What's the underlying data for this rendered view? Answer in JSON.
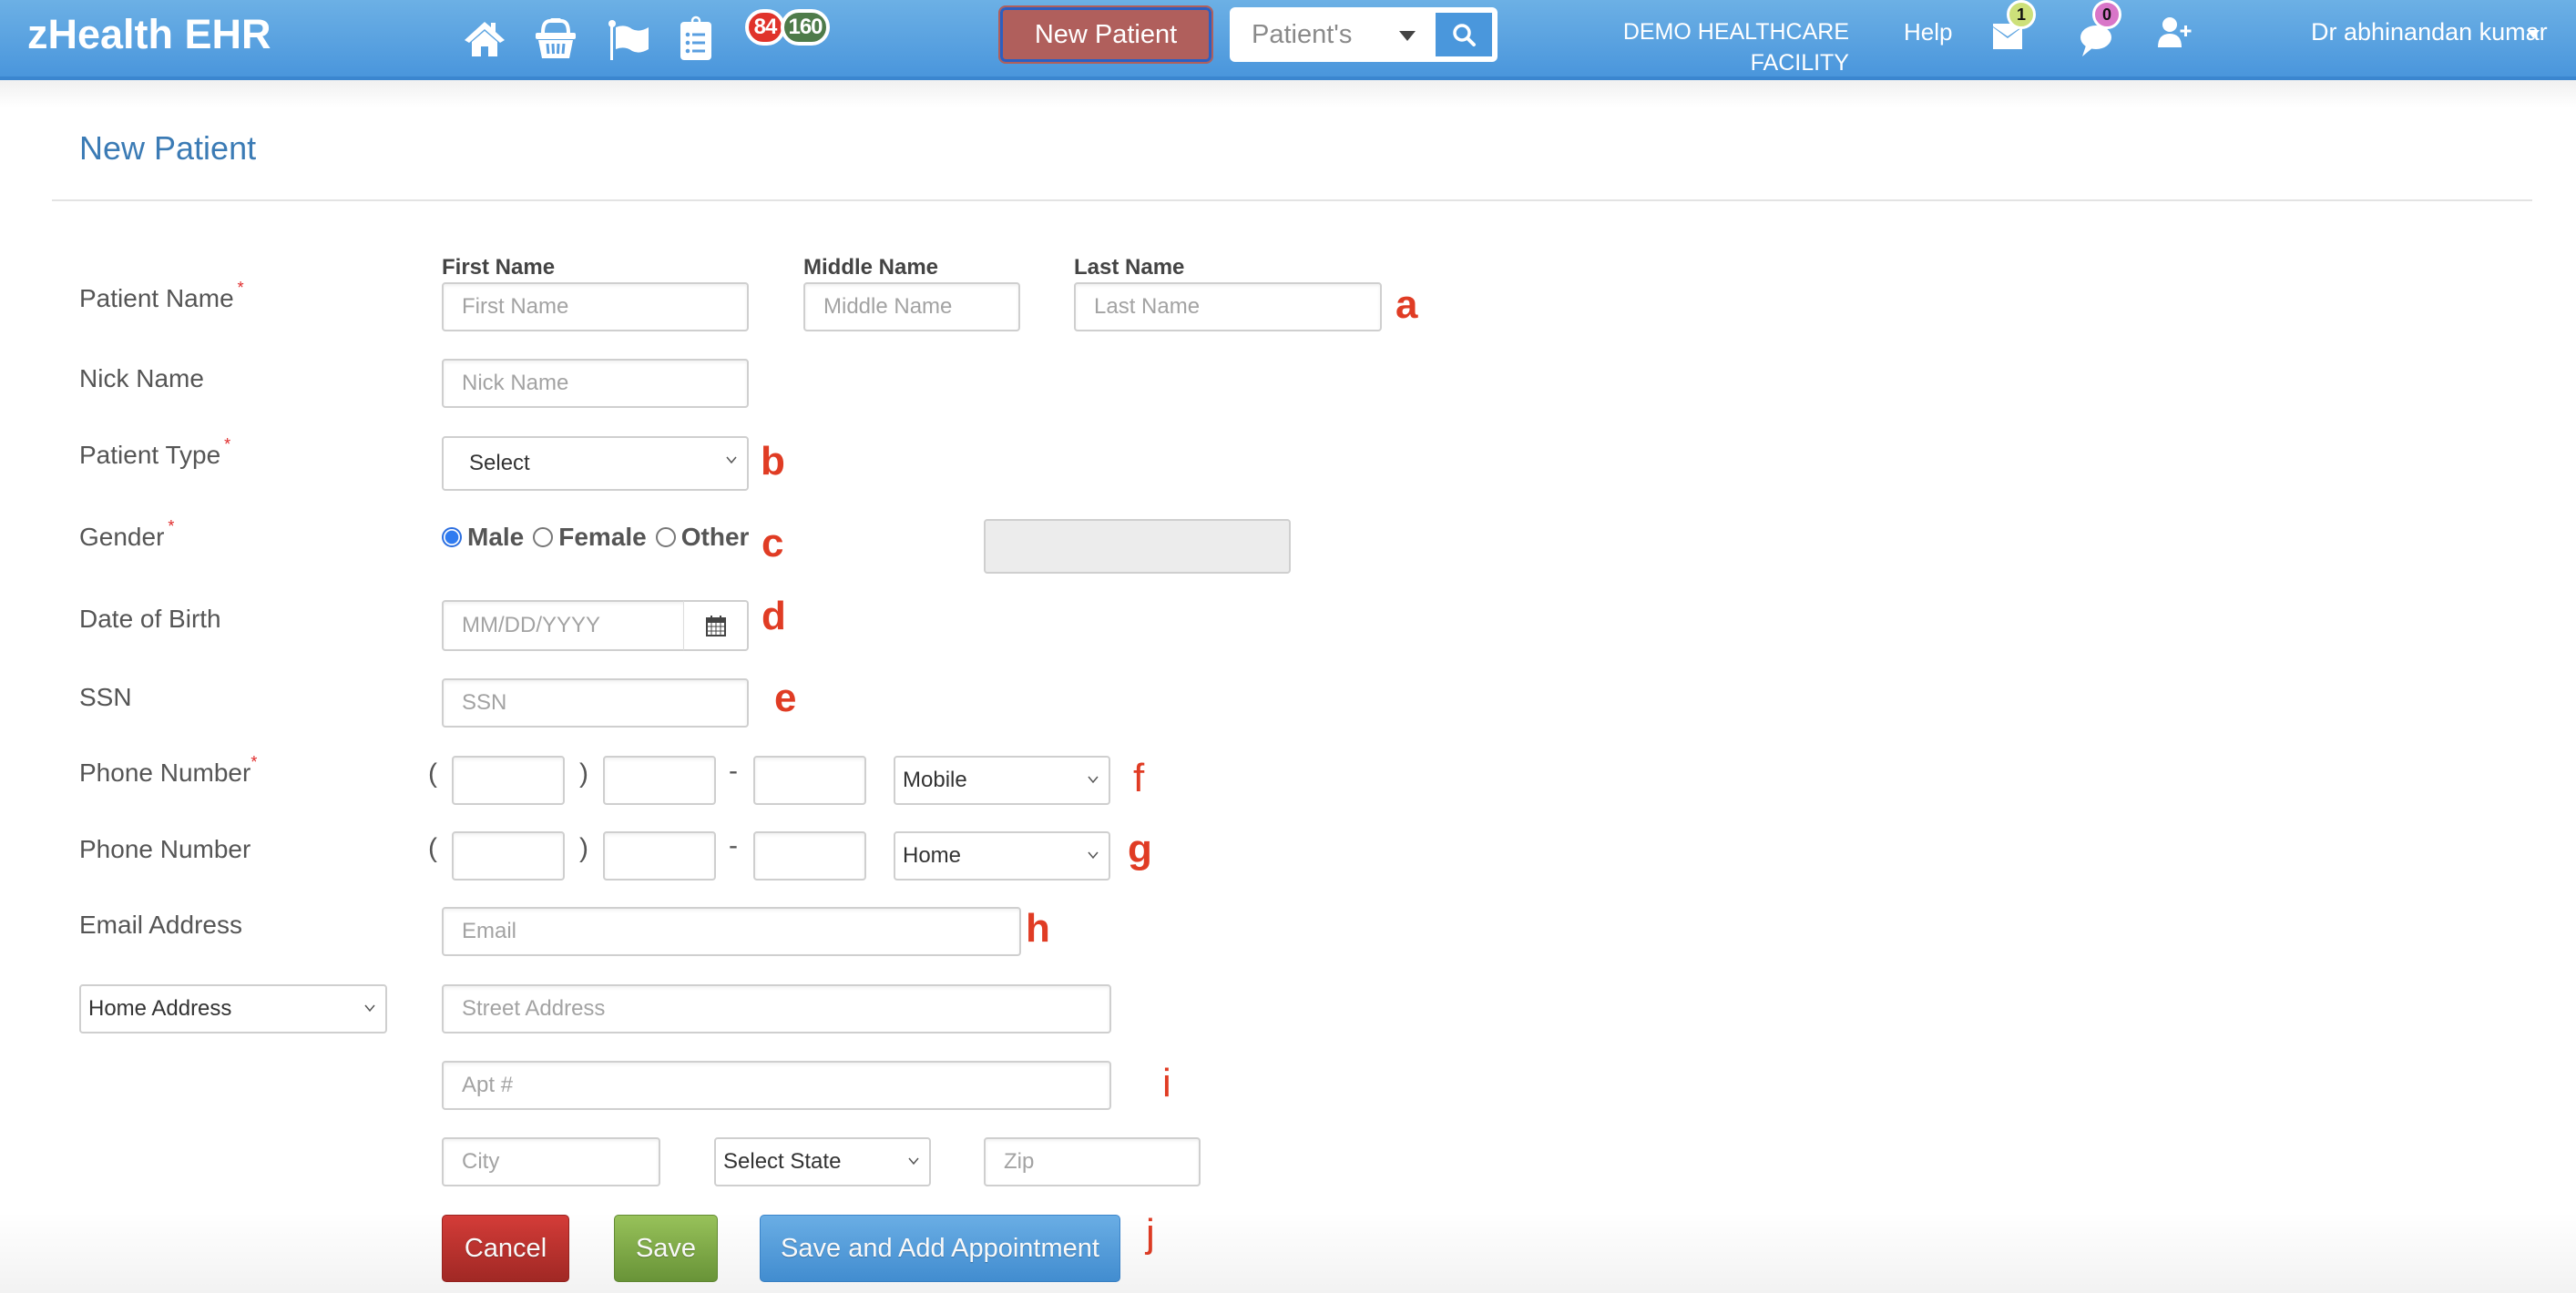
{
  "header": {
    "brand": "zHealth EHR",
    "nav_icons": [
      "home-icon",
      "basket-icon",
      "flag-icon",
      "clipboard-list-icon"
    ],
    "badges": [
      {
        "value": "84",
        "color": "#e0332b"
      },
      {
        "value": "160",
        "color": "#4e7b4a"
      }
    ],
    "new_patient_label": "New Patient",
    "search_select": "Patient's",
    "facility_line1": "DEMO HEALTHCARE",
    "facility_line2": "FACILITY",
    "help_label": "Help",
    "mail_count": "1",
    "mail_badge_color": "#cde07a",
    "chat_count": "0",
    "chat_badge_color": "#d876c8",
    "user_name": "Dr abhinandan kumar"
  },
  "page": {
    "title": "New Patient"
  },
  "form": {
    "patient_name": {
      "label": "Patient Name",
      "required": "*",
      "first_label": "First Name",
      "first_placeholder": "First Name",
      "middle_label": "Middle Name",
      "middle_placeholder": "Middle Name",
      "last_label": "Last Name",
      "last_placeholder": "Last Name",
      "annotation": "a"
    },
    "nick_name": {
      "label": "Nick Name",
      "placeholder": "Nick Name"
    },
    "patient_type": {
      "label": "Patient Type",
      "required": "*",
      "value": "Select",
      "annotation": "b"
    },
    "gender": {
      "label": "Gender",
      "required": "*",
      "options": [
        "Male",
        "Female",
        "Other"
      ],
      "selected": "Male",
      "annotation": "c"
    },
    "dob": {
      "label": "Date of Birth",
      "placeholder": "MM/DD/YYYY",
      "annotation": "d"
    },
    "ssn": {
      "label": "SSN",
      "placeholder": "SSN",
      "annotation": "e"
    },
    "phone1": {
      "label": "Phone Number",
      "required": "*",
      "open_paren": "(",
      "close_paren": ")",
      "dash": "-",
      "type": "Mobile",
      "annotation": "f"
    },
    "phone2": {
      "label": "Phone Number",
      "open_paren": "(",
      "close_paren": ")",
      "dash": "-",
      "type": "Home",
      "annotation": "g"
    },
    "email": {
      "label": "Email Address",
      "placeholder": "Email",
      "annotation": "h"
    },
    "address": {
      "type": "Home Address",
      "street_placeholder": "Street Address",
      "apt_placeholder": "Apt #",
      "city_placeholder": "City",
      "state": "Select State",
      "zip_placeholder": "Zip",
      "annotation": "i"
    },
    "actions": {
      "cancel": "Cancel",
      "save": "Save",
      "save_and_appointment": "Save and Add Appointment",
      "annotation": "j"
    }
  }
}
